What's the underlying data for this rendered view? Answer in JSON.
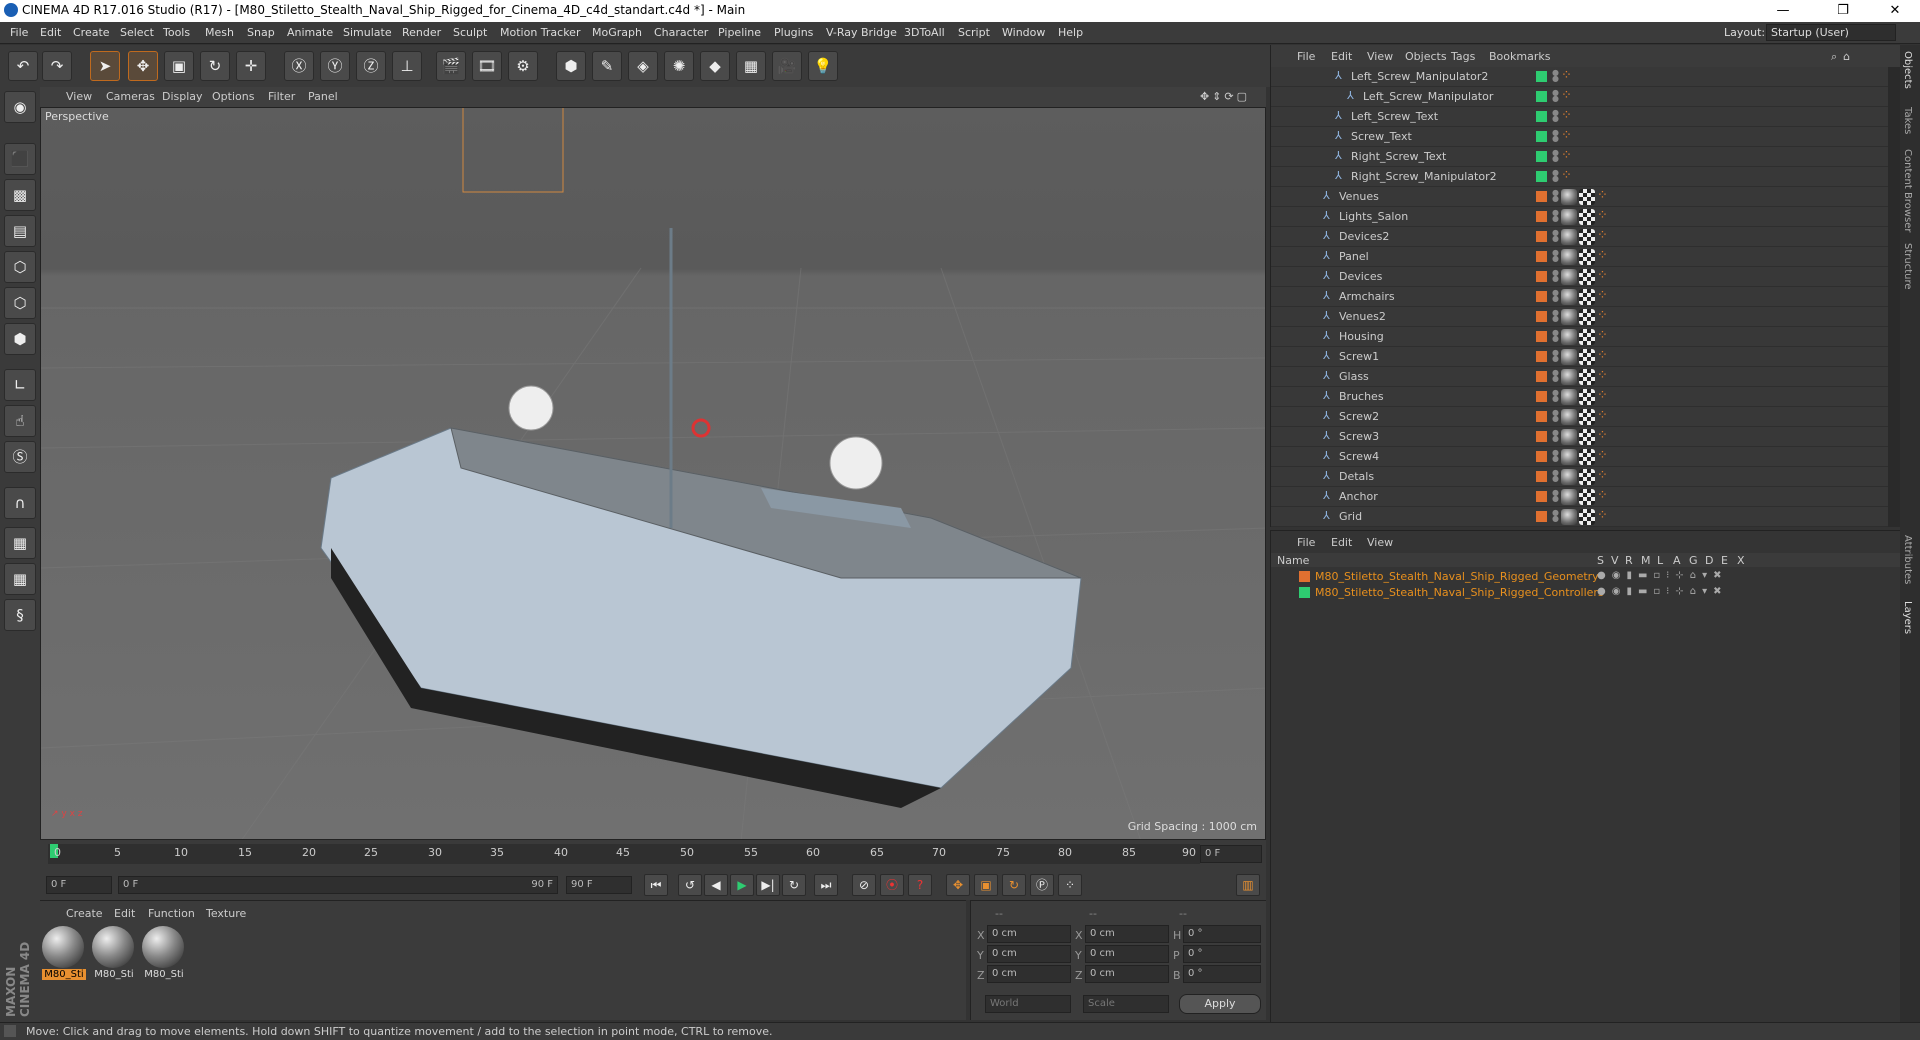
{
  "window": {
    "title": "CINEMA 4D R17.016 Studio (R17) - [M80_Stiletto_Stealth_Naval_Ship_Rigged_for_Cinema_4D_c4d_standart.c4d *] - Main"
  },
  "menubar": {
    "items": [
      "File",
      "Edit",
      "Create",
      "Select",
      "Tools",
      "Mesh",
      "Snap",
      "Animate",
      "Simulate",
      "Render",
      "Sculpt",
      "Motion Tracker",
      "MoGraph",
      "Character",
      "Pipeline",
      "Plugins",
      "V-Ray Bridge",
      "3DToAll",
      "Script",
      "Window",
      "Help"
    ],
    "layout_label": "Layout:",
    "layout_value": "Startup (User)"
  },
  "viewport": {
    "menu": [
      "View",
      "Cameras",
      "Display",
      "Options",
      "Filter",
      "Panel"
    ],
    "label": "Perspective",
    "grid_spacing": "Grid Spacing : 1000 cm"
  },
  "timeline": {
    "ticks": [
      "0",
      "5",
      "10",
      "15",
      "20",
      "25",
      "30",
      "35",
      "40",
      "45",
      "50",
      "55",
      "60",
      "65",
      "70",
      "75",
      "80",
      "85",
      "90"
    ],
    "end_frame": "0 F"
  },
  "transport": {
    "current": "0 F",
    "range_start": "0 F",
    "range_end": "90 F",
    "max": "90 F"
  },
  "materials": {
    "menu": [
      "Create",
      "Edit",
      "Function",
      "Texture"
    ],
    "items": [
      "M80_Sti",
      "M80_Sti",
      "M80_Sti"
    ]
  },
  "coords": {
    "headers": [
      "--",
      "--",
      "--"
    ],
    "rows": [
      {
        "a": "X",
        "av": "0 cm",
        "b": "X",
        "bv": "0 cm",
        "c": "H",
        "cv": "0 °"
      },
      {
        "a": "Y",
        "av": "0 cm",
        "b": "Y",
        "bv": "0 cm",
        "c": "P",
        "cv": "0 °"
      },
      {
        "a": "Z",
        "av": "0 cm",
        "b": "Z",
        "bv": "0 cm",
        "c": "B",
        "cv": "0 °"
      }
    ],
    "mode1": "World",
    "mode2": "Scale",
    "apply": "Apply"
  },
  "objects": {
    "menu": [
      "File",
      "Edit",
      "View",
      "Objects",
      "Tags",
      "Bookmarks"
    ],
    "rows": [
      {
        "name": "Left_Screw_Manipulator2",
        "indent": 2,
        "color": "#2ecc71"
      },
      {
        "name": "Left_Screw_Manipulator",
        "indent": 3,
        "color": "#2ecc71"
      },
      {
        "name": "Left_Screw_Text",
        "indent": 2,
        "color": "#2ecc71"
      },
      {
        "name": "Screw_Text",
        "indent": 2,
        "color": "#2ecc71"
      },
      {
        "name": "Right_Screw_Text",
        "indent": 2,
        "color": "#2ecc71"
      },
      {
        "name": "Right_Screw_Manipulator2",
        "indent": 2,
        "color": "#2ecc71"
      },
      {
        "name": "Venues",
        "indent": 1,
        "color": "#e07030"
      },
      {
        "name": "Lights_Salon",
        "indent": 1,
        "color": "#e07030"
      },
      {
        "name": "Devices2",
        "indent": 1,
        "color": "#e07030"
      },
      {
        "name": "Panel",
        "indent": 1,
        "color": "#e07030"
      },
      {
        "name": "Devices",
        "indent": 1,
        "color": "#e07030"
      },
      {
        "name": "Armchairs",
        "indent": 1,
        "color": "#e07030"
      },
      {
        "name": "Venues2",
        "indent": 1,
        "color": "#e07030"
      },
      {
        "name": "Housing",
        "indent": 1,
        "color": "#e07030"
      },
      {
        "name": "Screw1",
        "indent": 1,
        "color": "#e07030"
      },
      {
        "name": "Glass",
        "indent": 1,
        "color": "#e07030"
      },
      {
        "name": "Bruches",
        "indent": 1,
        "color": "#e07030"
      },
      {
        "name": "Screw2",
        "indent": 1,
        "color": "#e07030"
      },
      {
        "name": "Screw3",
        "indent": 1,
        "color": "#e07030"
      },
      {
        "name": "Screw4",
        "indent": 1,
        "color": "#e07030"
      },
      {
        "name": "Detals",
        "indent": 1,
        "color": "#e07030"
      },
      {
        "name": "Anchor",
        "indent": 1,
        "color": "#e07030"
      },
      {
        "name": "Grid",
        "indent": 1,
        "color": "#e07030"
      }
    ]
  },
  "layers": {
    "menu": [
      "File",
      "Edit",
      "View"
    ],
    "header": {
      "name": "Name",
      "cols": [
        "S",
        "V",
        "R",
        "M",
        "L",
        "A",
        "G",
        "D",
        "E",
        "X"
      ]
    },
    "items": [
      {
        "name": "M80_Stiletto_Stealth_Naval_Ship_Rigged_Geometry",
        "color": "#e07030"
      },
      {
        "name": "M80_Stiletto_Stealth_Naval_Ship_Rigged_Controllers",
        "color": "#2ecc71"
      }
    ]
  },
  "right_tabs": [
    "Objects",
    "Takes",
    "Content Browser",
    "Structure",
    "Attributes",
    "Layers"
  ],
  "status": "Move: Click and drag to move elements. Hold down SHIFT to quantize movement / add to the selection in point mode, CTRL to remove."
}
